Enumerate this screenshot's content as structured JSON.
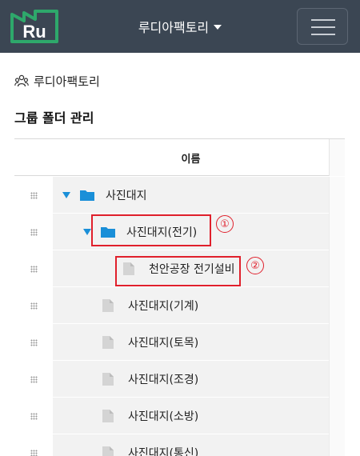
{
  "app": {
    "logo_text": "Ru",
    "org_name": "루디아팩토리"
  },
  "breadcrumb": {
    "label": "루디아팩토리"
  },
  "page": {
    "title": "그룹 폴더 관리"
  },
  "table": {
    "header_name": "이름",
    "rows": [
      {
        "label": "사진대지",
        "type": "folder",
        "expanded": true,
        "level": 0
      },
      {
        "label": "사진대지(전기)",
        "type": "folder",
        "expanded": true,
        "level": 1
      },
      {
        "label": "천안공장 전기설비",
        "type": "file",
        "level": 2
      },
      {
        "label": "사진대지(기계)",
        "type": "file",
        "level": 1
      },
      {
        "label": "사진대지(토목)",
        "type": "file",
        "level": 1
      },
      {
        "label": "사진대지(조경)",
        "type": "file",
        "level": 1
      },
      {
        "label": "사진대지(소방)",
        "type": "file",
        "level": 1
      },
      {
        "label": "사진대지(통신)",
        "type": "file",
        "level": 1
      }
    ]
  },
  "annotations": {
    "marker_1": "①",
    "marker_2": "②"
  },
  "colors": {
    "topbar": "#3b4653",
    "logo_green": "#2ea86b",
    "folder_blue": "#1a8fd8",
    "highlight_red": "#e0202c"
  },
  "icons": {
    "logo": "factory-logo-icon",
    "dropdown": "caret-down-icon",
    "menu": "hamburger-menu-icon",
    "breadcrumb": "people-group-icon",
    "drag": "drag-handle-icon",
    "toggle": "expand-triangle-icon",
    "folder": "folder-icon",
    "file": "file-icon"
  }
}
